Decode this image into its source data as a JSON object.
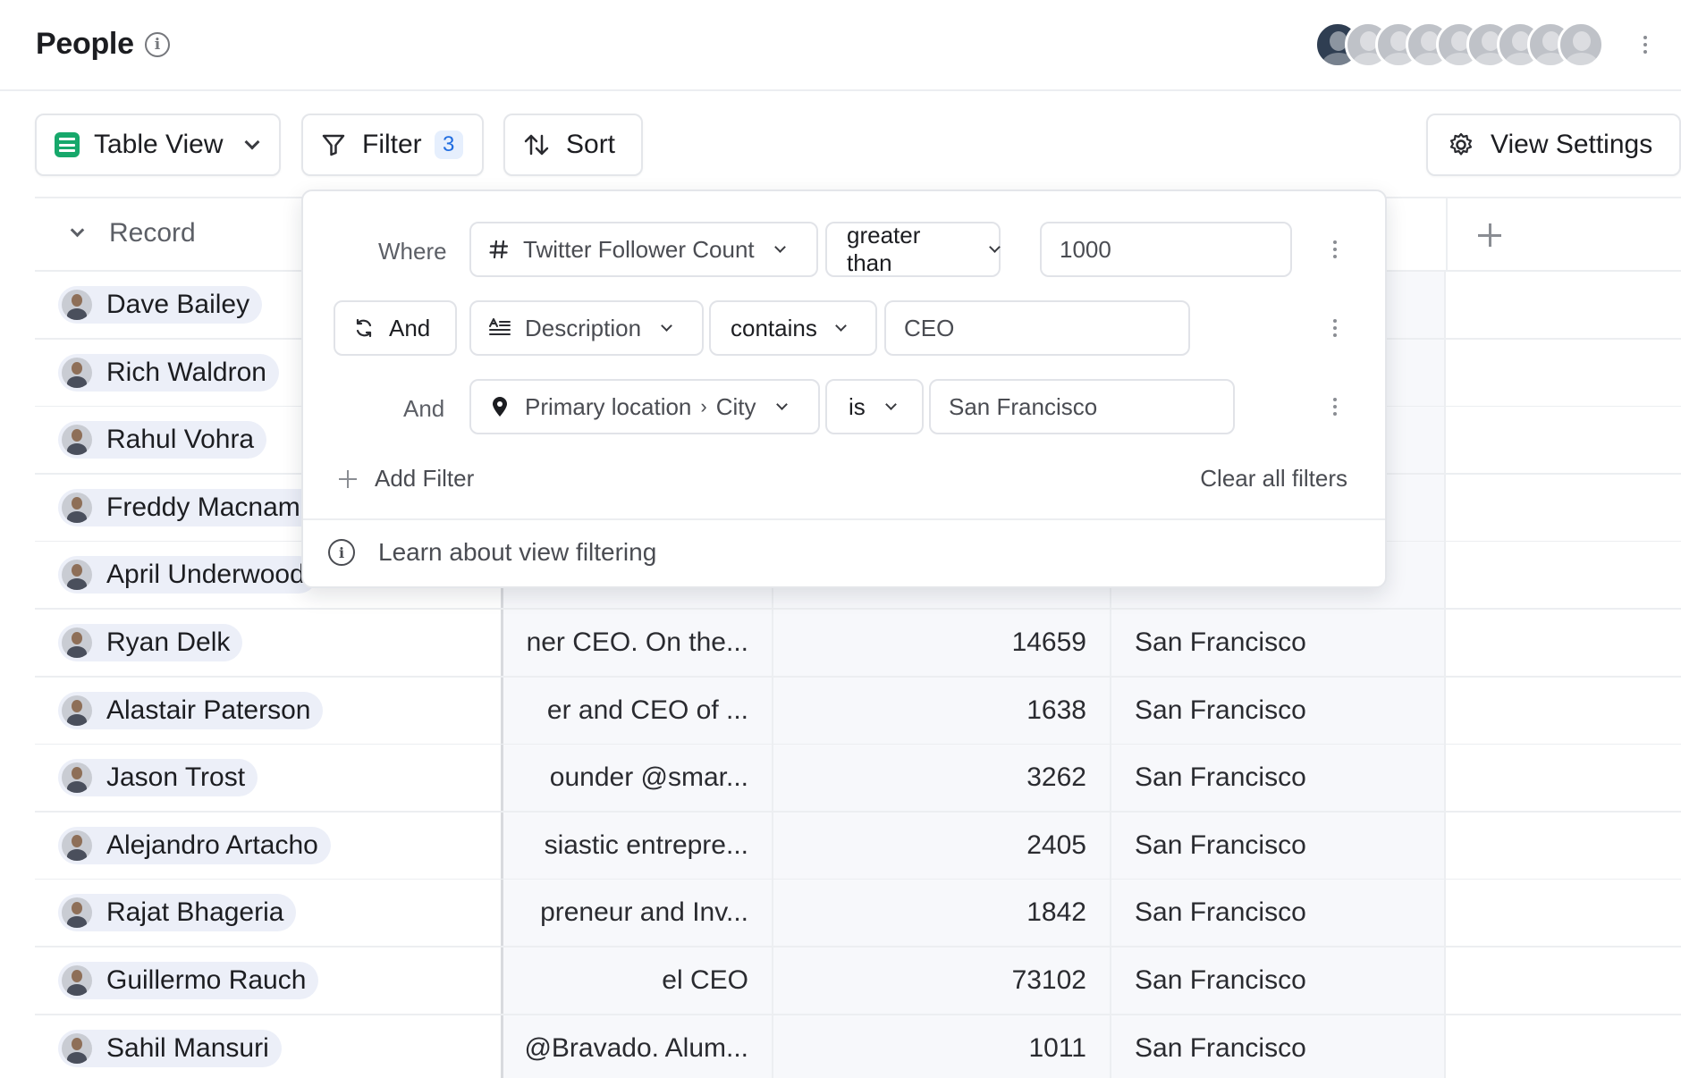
{
  "header": {
    "title": "People",
    "info_icon": "info-icon",
    "avatar_count": 9,
    "more_icon": "more-vertical-icon"
  },
  "toolbar": {
    "table_view_label": "Table View",
    "filter_label": "Filter",
    "filter_count": "3",
    "sort_label": "Sort",
    "view_settings_label": "View Settings"
  },
  "table": {
    "record_header": "Record",
    "rows": [
      {
        "name": "Dave Bailey",
        "desc": "",
        "count": "",
        "city": ""
      },
      {
        "name": "Rich Waldron",
        "desc": "",
        "count": "",
        "city": ""
      },
      {
        "name": "Rahul Vohra",
        "desc": "",
        "count": "",
        "city": ""
      },
      {
        "name": "Freddy Macnamara",
        "desc": "",
        "count": "",
        "city": ""
      },
      {
        "name": "April Underwood",
        "desc": "",
        "count": "",
        "city": ""
      },
      {
        "name": "Ryan Delk",
        "desc": "ner CEO. On the...",
        "count": "14659",
        "city": "San Francisco"
      },
      {
        "name": "Alastair Paterson",
        "desc": "er and CEO of ...",
        "count": "1638",
        "city": "San Francisco"
      },
      {
        "name": "Jason Trost",
        "desc": "ounder @smar...",
        "count": "3262",
        "city": "San Francisco"
      },
      {
        "name": "Alejandro Artacho",
        "desc": "siastic entrepre...",
        "count": "2405",
        "city": "San Francisco"
      },
      {
        "name": "Rajat Bhageria",
        "desc": "preneur and Inv...",
        "count": "1842",
        "city": "San Francisco"
      },
      {
        "name": "Guillermo Rauch",
        "desc": "el CEO",
        "count": "73102",
        "city": "San Francisco"
      },
      {
        "name": "Sahil Mansuri",
        "desc": "@Bravado. Alum...",
        "count": "1011",
        "city": "San Francisco"
      }
    ]
  },
  "filter_panel": {
    "filters": [
      {
        "conjunction": "Where",
        "field": "Twitter Follower Count",
        "field_icon": "hash-icon",
        "operator": "greater than",
        "value": "1000"
      },
      {
        "conjunction": "And",
        "field": "Description",
        "field_icon": "text-lines-icon",
        "operator": "contains",
        "value": "CEO"
      },
      {
        "conjunction": "And",
        "field": "Primary location",
        "field_sub": "City",
        "field_icon": "location-pin-icon",
        "operator": "is",
        "value": "San Francisco"
      }
    ],
    "add_filter_label": "Add Filter",
    "clear_all_label": "Clear all filters",
    "learn_label": "Learn about view filtering"
  },
  "colors": {
    "accent_blue": "#1f6ce0",
    "table_view_green": "#17a86b",
    "chip_bg": "#eceff8"
  }
}
